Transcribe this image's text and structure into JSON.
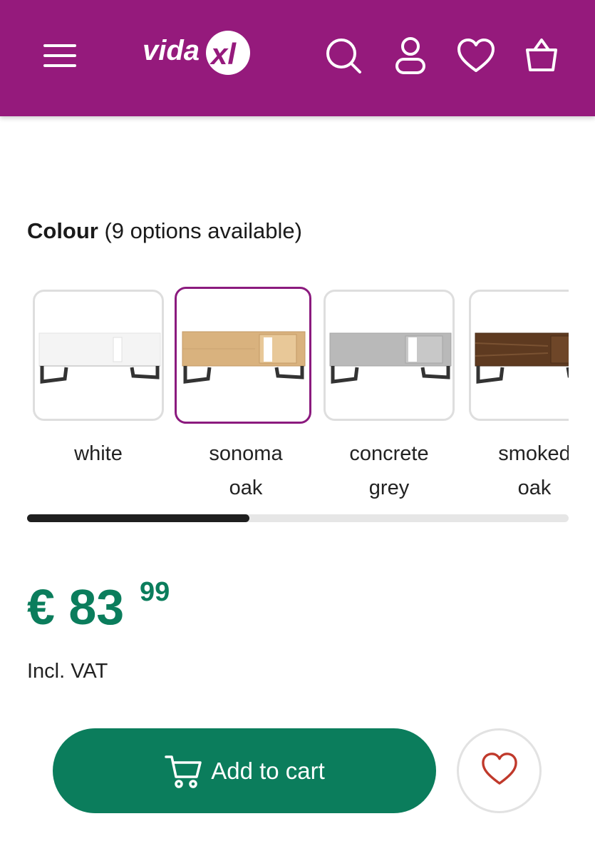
{
  "header": {
    "brand": "vidaXL",
    "background_color": "#951a7c",
    "menu_icon": "hamburger-menu-icon",
    "search_icon": "search-icon",
    "account_icon": "user-icon",
    "wishlist_icon": "heart-icon",
    "cart_icon": "basket-icon"
  },
  "colour": {
    "heading_bold": "Colour",
    "heading_rest": " (9 options available)",
    "selected_index": 1,
    "selected_border_color": "#8b1a7e",
    "options": [
      {
        "label_line1": "white",
        "label_line2": "",
        "finish_color": "#f4f4f4"
      },
      {
        "label_line1": "sonoma",
        "label_line2": "oak",
        "finish_color": "#d9b27e"
      },
      {
        "label_line1": "concrete",
        "label_line2": "grey",
        "finish_color": "#b9b9b9"
      },
      {
        "label_line1": "smoked",
        "label_line2": "oak",
        "finish_color": "#5e3a20"
      }
    ],
    "scroll_progress": 0.41
  },
  "price": {
    "currency_and_whole": "€ 83",
    "cents": "99",
    "vat_note": "Incl. VAT",
    "color": "#0b7d5c"
  },
  "actions": {
    "add_to_cart_label": "Add to cart",
    "add_to_cart_icon": "cart-icon",
    "wishlist_icon": "heart-outline-icon",
    "button_color": "#0b7d5c",
    "heart_color": "#c0392b"
  }
}
